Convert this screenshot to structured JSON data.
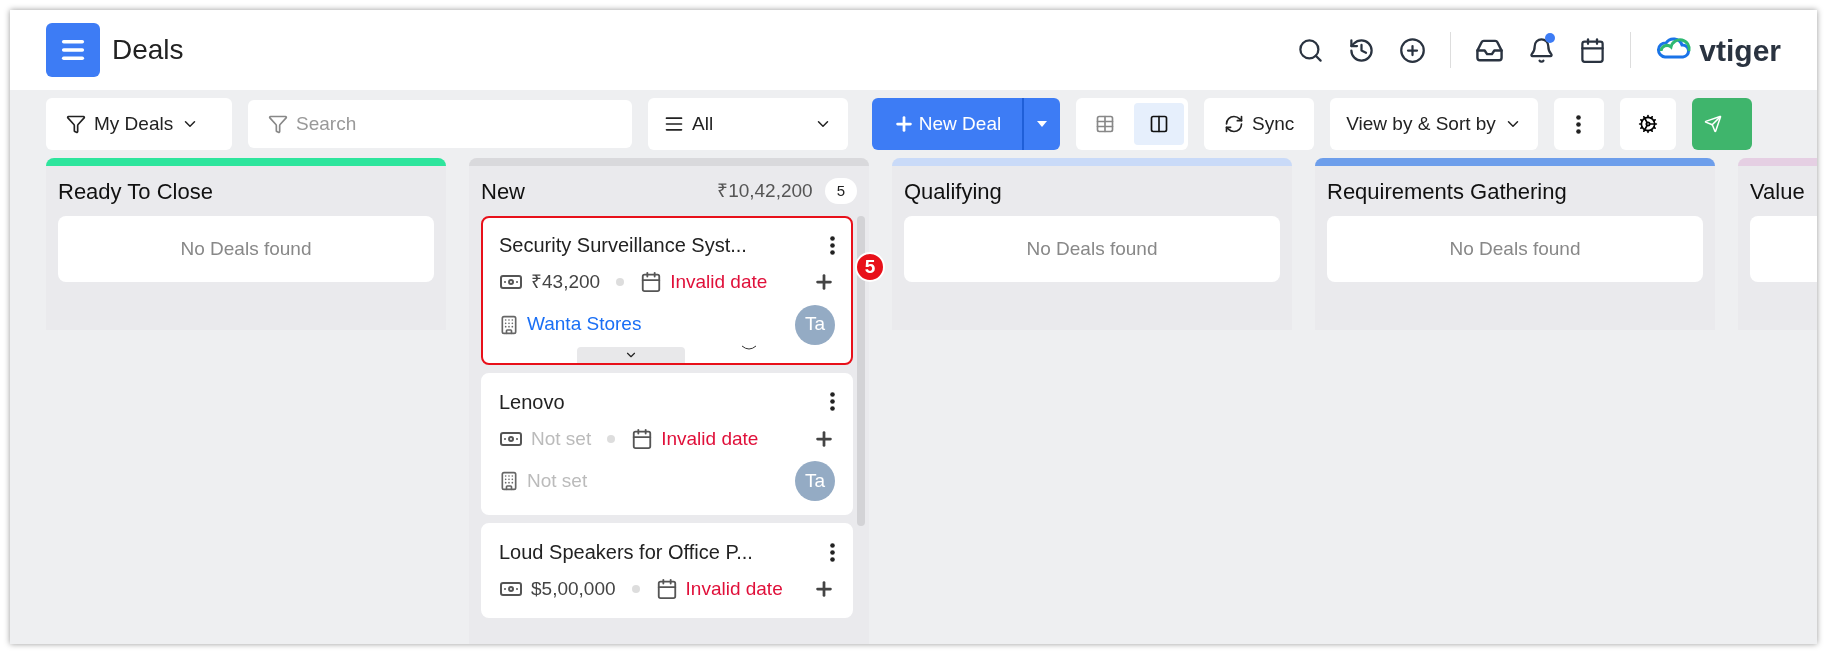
{
  "header": {
    "title": "Deals",
    "logo_text": "vtiger",
    "notification_unread": true
  },
  "toolbar": {
    "filter": "My Deals",
    "search": {
      "placeholder": "Search"
    },
    "list_select": "All",
    "new_button": "New Deal",
    "sync": "Sync",
    "view_sort": "View by & Sort by",
    "view_toggle": [
      {
        "kind": "list",
        "selected": false
      },
      {
        "kind": "kanban",
        "selected": true
      }
    ]
  },
  "columns": [
    {
      "title": "Ready To Close",
      "color": "#2ee59d",
      "empty_text": "No Deals found"
    },
    {
      "title": "New",
      "color": "#d9d9dc",
      "total": "₹10,42,200",
      "count": "5",
      "deals": [
        {
          "name": "Security Surveillance Syst...",
          "amount": "₹43,200",
          "amount_set": true,
          "close_date": "Invalid date",
          "date_invalid": true,
          "account": "Wanta Stores",
          "account_set": true,
          "owner": "Ta",
          "highlighted": true,
          "step_badge": "5"
        },
        {
          "name": "Lenovo",
          "amount": "Not set",
          "amount_set": false,
          "close_date": "Invalid date",
          "date_invalid": true,
          "account": "Not set",
          "account_set": false,
          "owner": "Ta",
          "highlighted": false
        },
        {
          "name": "Loud Speakers for Office P...",
          "amount": "$5,00,000",
          "amount_set": true,
          "close_date": "Invalid date",
          "date_invalid": true,
          "highlighted": false
        }
      ]
    },
    {
      "title": "Qualifying",
      "color": "#c9daf8",
      "empty_text": "No Deals found"
    },
    {
      "title": "Requirements Gathering",
      "color": "#6d9eeb",
      "empty_text": "No Deals found"
    },
    {
      "title": "Value",
      "color": "#e5cfe3"
    }
  ]
}
